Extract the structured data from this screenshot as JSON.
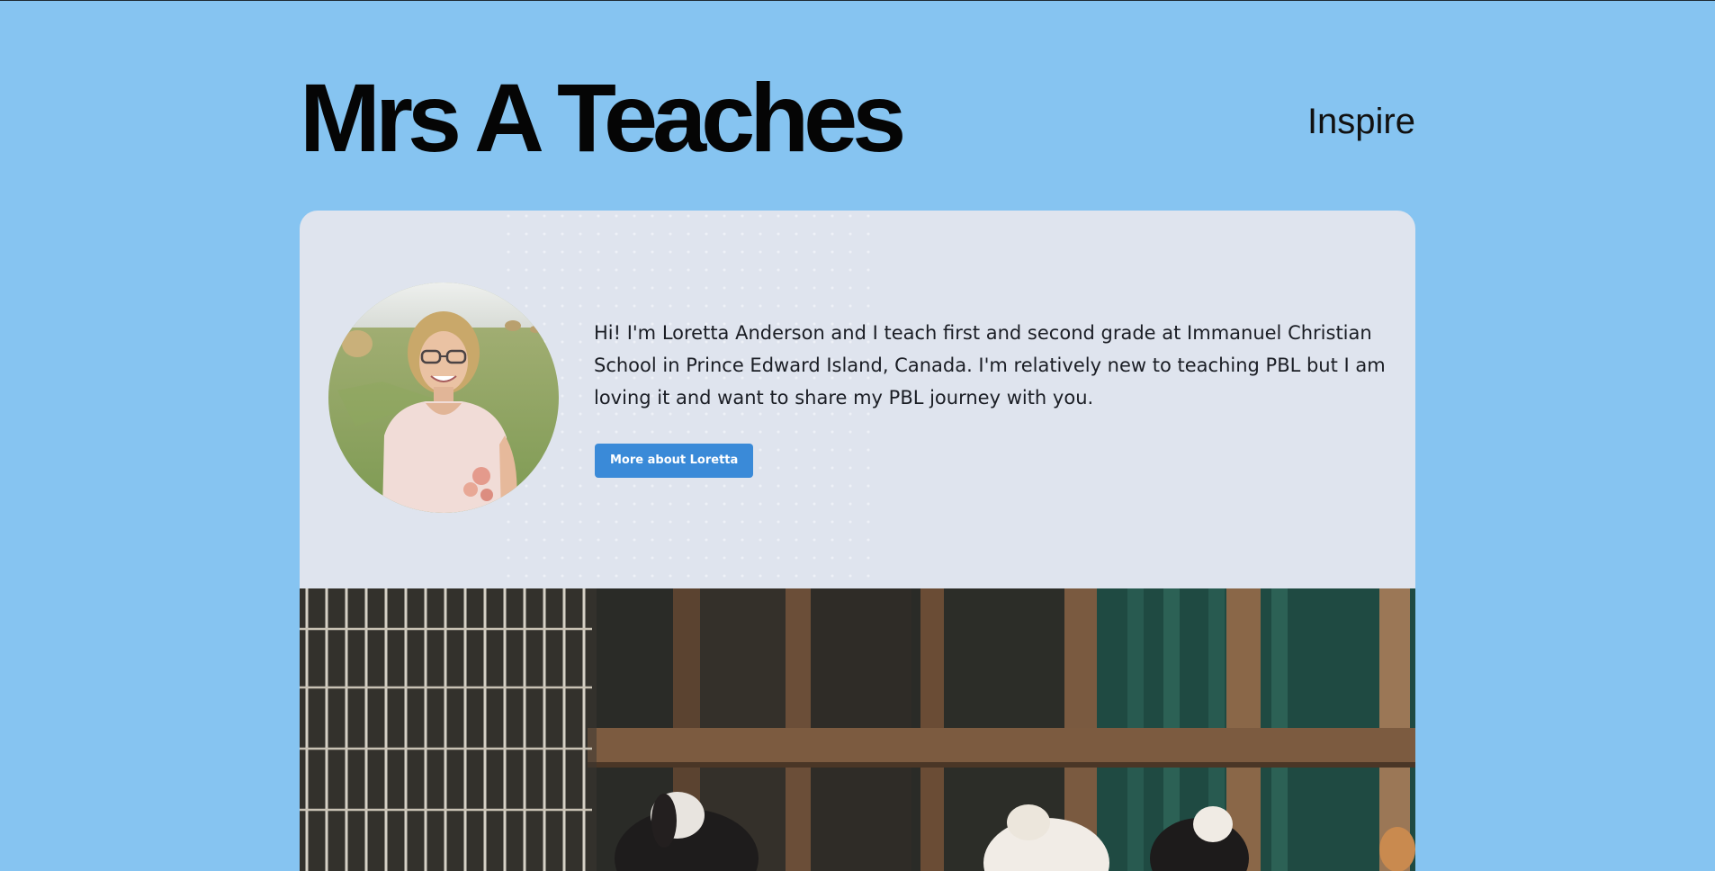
{
  "site": {
    "title": "Mrs A Teaches"
  },
  "nav": {
    "items": [
      {
        "label": "Inspire"
      }
    ]
  },
  "intro": {
    "bio": "Hi! I'm Loretta Anderson and I teach first and second grade at Immanuel Christian School in Prince Edward Island, Canada. I'm relatively new to teaching PBL but I am loving it and want to share my PBL journey with you.",
    "button_label": "More about Loretta"
  },
  "colors": {
    "page_background": "#86c4f1",
    "card_background": "#dfe4ee",
    "button": "#3a8ad8",
    "title_text": "#050505"
  }
}
